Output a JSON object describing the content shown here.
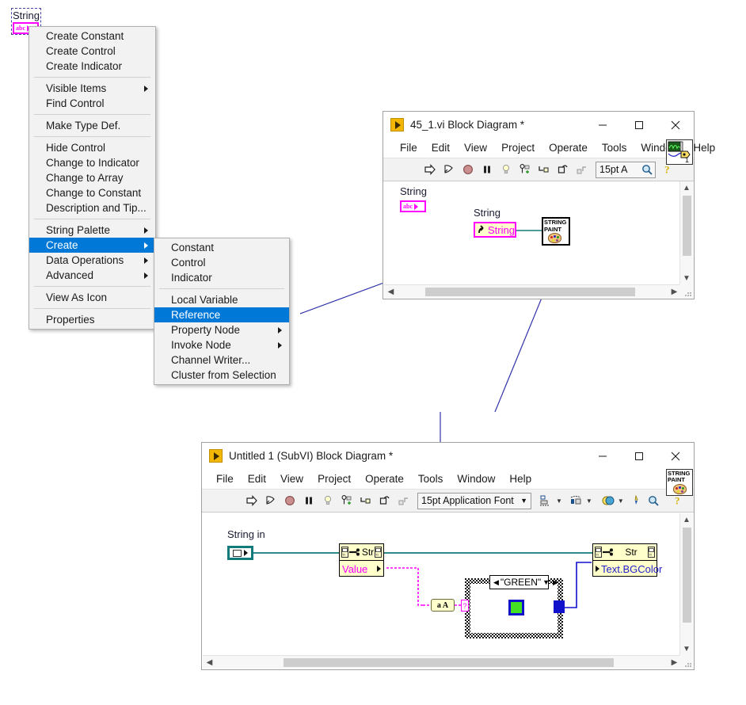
{
  "desktop": {
    "background": "#ffffff"
  },
  "string_control": {
    "label": "String",
    "terminal_text": "abc",
    "border_color": "#ff00ff"
  },
  "context_menu": {
    "items": [
      {
        "label": "Create Constant",
        "submenu": false,
        "selected": false
      },
      {
        "label": "Create Control",
        "submenu": false,
        "selected": false
      },
      {
        "label": "Create Indicator",
        "submenu": false,
        "selected": false
      },
      {
        "separator": true
      },
      {
        "label": "Visible Items",
        "submenu": true,
        "selected": false
      },
      {
        "label": "Find Control",
        "submenu": false,
        "selected": false
      },
      {
        "separator": true
      },
      {
        "label": "Make Type Def.",
        "submenu": false,
        "selected": false
      },
      {
        "separator": true
      },
      {
        "label": "Hide Control",
        "submenu": false,
        "selected": false
      },
      {
        "label": "Change to Indicator",
        "submenu": false,
        "selected": false
      },
      {
        "label": "Change to Array",
        "submenu": false,
        "selected": false
      },
      {
        "label": "Change to Constant",
        "submenu": false,
        "selected": false
      },
      {
        "label": "Description and Tip...",
        "submenu": false,
        "selected": false
      },
      {
        "separator": true
      },
      {
        "label": "String Palette",
        "submenu": true,
        "selected": false
      },
      {
        "label": "Create",
        "submenu": true,
        "selected": true
      },
      {
        "label": "Data Operations",
        "submenu": true,
        "selected": false
      },
      {
        "label": "Advanced",
        "submenu": true,
        "selected": false
      },
      {
        "separator": true
      },
      {
        "label": "View As Icon",
        "submenu": false,
        "selected": false
      },
      {
        "separator": true
      },
      {
        "label": "Properties",
        "submenu": false,
        "selected": false
      }
    ]
  },
  "create_submenu": {
    "items": [
      {
        "label": "Constant",
        "submenu": false,
        "selected": false
      },
      {
        "label": "Control",
        "submenu": false,
        "selected": false
      },
      {
        "label": "Indicator",
        "submenu": false,
        "selected": false
      },
      {
        "separator": true
      },
      {
        "label": "Local Variable",
        "submenu": false,
        "selected": false
      },
      {
        "label": "Reference",
        "submenu": false,
        "selected": true
      },
      {
        "label": "Property Node",
        "submenu": true,
        "selected": false
      },
      {
        "label": "Invoke Node",
        "submenu": true,
        "selected": false
      },
      {
        "label": "Channel Writer...",
        "submenu": false,
        "selected": false
      },
      {
        "label": "Cluster from Selection",
        "submenu": false,
        "selected": false
      }
    ]
  },
  "window_main": {
    "title": "45_1.vi Block Diagram *",
    "minimize_label": "—",
    "maximize_label": "□",
    "close_label": "✕",
    "menus": [
      "File",
      "Edit",
      "View",
      "Project",
      "Operate",
      "Tools",
      "Window",
      "Help"
    ],
    "toolbar": {
      "run_icon": "run-arrow-icon",
      "run_continuous_icon": "run-continuously-icon",
      "abort_icon": "abort-execution-icon",
      "pause_icon": "pause-icon",
      "highlight_icon": "highlight-execution-icon",
      "retain_icon": "retain-wire-values-icon",
      "stepinto_icon": "step-into-icon",
      "stepover_icon": "step-over-icon",
      "stepout_icon": "step-out-icon",
      "font_value": "15pt A",
      "search_icon": "search-icon",
      "help_icon": "help-icon"
    },
    "vi_icon_number": "1",
    "diagram": {
      "control_label": "String",
      "control_terminal_text": "abc",
      "reference_label": "String",
      "reference_node_text": "String",
      "subvi_line1": "STRING",
      "subvi_line2": "PAINT"
    }
  },
  "window_subvi": {
    "title": "Untitled 1 (SubVI) Block Diagram *",
    "minimize_label": "—",
    "maximize_label": "□",
    "close_label": "✕",
    "menus": [
      "File",
      "Edit",
      "View",
      "Project",
      "Operate",
      "Tools",
      "Window",
      "Help"
    ],
    "toolbar": {
      "font_value": "15pt Application Font",
      "align_icon": "align-objects-icon",
      "distribute_icon": "distribute-objects-icon",
      "reorder_icon": "reorder-icon",
      "cleanup_icon": "clean-up-diagram-icon",
      "search_icon": "search-icon",
      "help_icon": "help-icon"
    },
    "vi_icon_line1": "STRING",
    "vi_icon_line2": "PAINT",
    "diagram": {
      "input_label": "String in",
      "propnode_left_type": "Str",
      "propnode_left_property": "Value",
      "propnode_right_type": "Str",
      "propnode_right_property": "Text.BGColor",
      "case_selector_value": "\"GREEN\"",
      "case_selector_left_arrow": "◀",
      "case_selector_right_arrow": "▼",
      "case_selector_increment": "▶",
      "selector_terminal_glyph": "?",
      "to_upper_node": "a A",
      "color_constant_hex": "#44e024"
    }
  },
  "colors": {
    "magenta": "#ff00ff",
    "teal_wire": "#137b7b",
    "blue_wire": "#1111cc",
    "menu_highlight": "#0078d7",
    "leader_line": "#3333aa",
    "node_yellow": "#ffffcc"
  }
}
